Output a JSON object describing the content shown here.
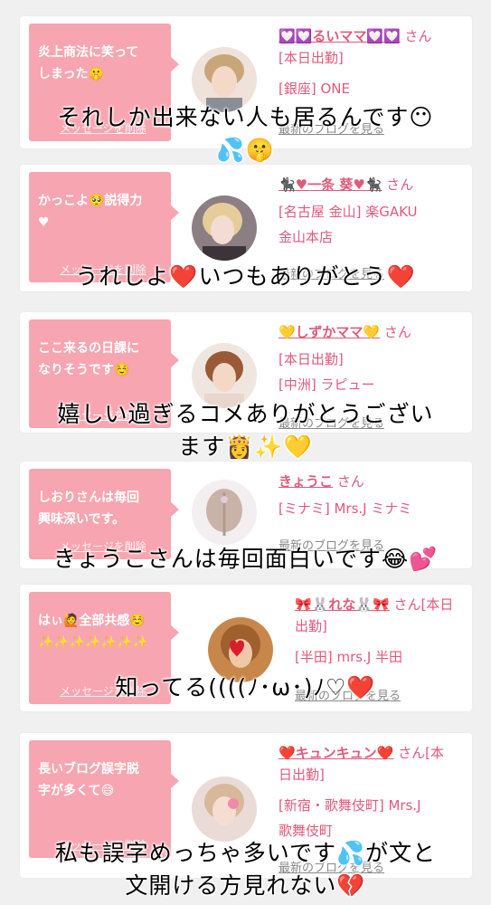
{
  "cards": [
    {
      "message": "炎上商法に笑って\nしまった🤫",
      "delete_label": "メッセージを削除",
      "name": "💟💟るいママ💟💟",
      "name_suffix": "さん[本日出勤]",
      "shop": "[銀座] ONE",
      "blog_label": "最新のブログを見る"
    },
    {
      "message": "かっこよ🥺説得力\n♥",
      "delete_label": "メッセージを削除",
      "name": "🐈‍⬛♥一条 葵♥🐈‍⬛",
      "name_suffix": "さん",
      "shop": "[名古屋 金山] 楽GAKU\n金山本店",
      "blog_label": "最新のブログを見る"
    },
    {
      "message": "ここ来るの日課に\nなりそうです☺️",
      "delete_label": "メッセージを削除",
      "name": "💛しずかママ💛",
      "name_suffix": "さん",
      "shop": "[本日出勤]\n[中洲] ラピュー",
      "blog_label": "最新のブログを見る"
    },
    {
      "message": "しおりさんは毎回\n興味深いです。",
      "delete_label": "メッセージを削除",
      "name": "きょうこ",
      "name_suffix": "さん",
      "shop": "[ミナミ] Mrs.J ミナミ",
      "blog_label": "最新のブログを見る"
    },
    {
      "message": "はぃ🙋全部共感☺️\n✨✨✨✨✨✨✨",
      "delete_label": "メッセージを削除",
      "name": "🎀🐰れな🐰🎀",
      "name_suffix": "さん[本日出勤]",
      "shop": "[半田] mrs.J 半田",
      "blog_label": "最新のブログを見る"
    },
    {
      "message": "長いブログ誤字脱\n字が多くて😅",
      "delete_label": "メッセージを削除",
      "name": "❤️キュンキュン❤️",
      "name_suffix": "さん[本日出勤]",
      "shop": "[新宿・歌舞伎町] Mrs.J\n歌舞伎町",
      "blog_label": "最新のブログを見る"
    }
  ],
  "captions": [
    "それしか出来ない人も居るんです😶\n💦🤫",
    "うれしよ❤️いつもありがとう❤️",
    "嬉しい過ぎるコメありがとうござい\nます👸✨💛",
    "きょうこさんは毎回面白いです😂💕",
    "知ってる((((ﾉ･ω･)ﾉ♡❤️",
    "私も誤字めっちゃ多いです💦が文と\n文開ける方見れない💔"
  ]
}
